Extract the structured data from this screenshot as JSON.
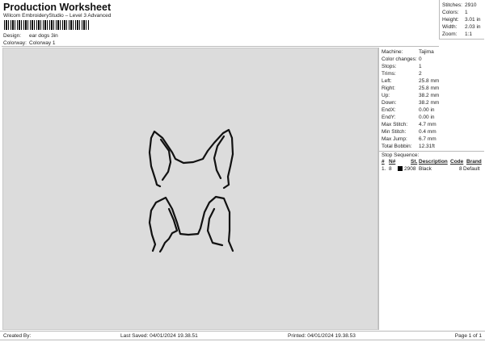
{
  "header": {
    "title": "Production Worksheet",
    "subtitle": "Wilcom EmbroideryStudio – Level 3 Advanced",
    "design_label": "Design:",
    "design_value": "ear  dogs 3in",
    "colorway_label": "Colorway:",
    "colorway_value": "Colorway 1"
  },
  "stats": [
    {
      "label": "Stitches:",
      "value": "2910"
    },
    {
      "label": "Colors:",
      "value": "1"
    },
    {
      "label": "Height:",
      "value": "3.01 in"
    },
    {
      "label": "Width:",
      "value": "2.03 in"
    },
    {
      "label": "Zoom:",
      "value": "1:1"
    }
  ],
  "details": [
    {
      "label": "Machine:",
      "value": "Tajima"
    },
    {
      "label": "Color changes:",
      "value": "0"
    },
    {
      "label": "Stops:",
      "value": "1"
    },
    {
      "label": "Trims:",
      "value": "2"
    },
    {
      "label": "Left:",
      "value": "25.8 mm"
    },
    {
      "label": "Right:",
      "value": "25.8 mm"
    },
    {
      "label": "Up:",
      "value": "38.2 mm"
    },
    {
      "label": "Down:",
      "value": "38.2 mm"
    },
    {
      "label": "EndX:",
      "value": "0.00 in"
    },
    {
      "label": "EndY:",
      "value": "0.00 in"
    },
    {
      "label": "Max Stitch:",
      "value": "4.7 mm"
    },
    {
      "label": "Min Stitch:",
      "value": "0.4 mm"
    },
    {
      "label": "Max Jump:",
      "value": "6.7 mm"
    },
    {
      "label": "Total Bobbin:",
      "value": "12.31ft"
    }
  ],
  "stop_sequence": {
    "title": "Stop Sequence:",
    "headers": [
      "#",
      "N#",
      "St.",
      "Description",
      "Code",
      "Brand"
    ],
    "rows": [
      {
        "num": "1.",
        "n": "8",
        "st": "2908",
        "description": "Black",
        "code": "8",
        "brand": "Default",
        "color": "#000000"
      }
    ]
  },
  "footer": {
    "created_by": "Created By:",
    "last_saved": "Last Saved: 04/01/2024 19.38.51",
    "printed": "Printed: 04/01/2024 19.38.53",
    "page": "Page 1 of 1"
  }
}
